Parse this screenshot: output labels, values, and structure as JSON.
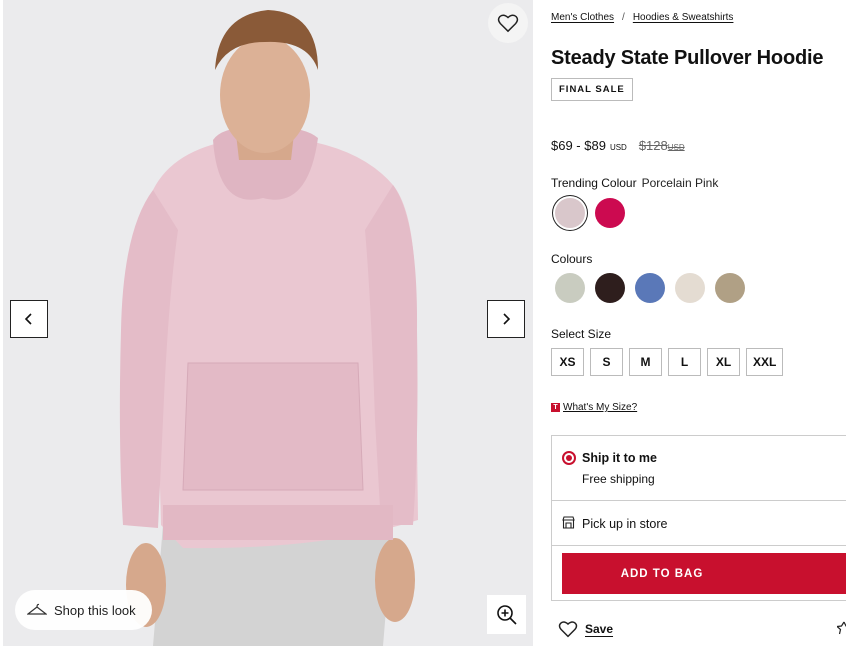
{
  "gallery": {
    "shop_look_label": "Shop this look",
    "icons": [
      "heart-icon",
      "chevron-left-icon",
      "chevron-right-icon",
      "hanger-icon",
      "zoom-in-icon"
    ]
  },
  "breadcrumb": [
    {
      "label": "Men's Clothes"
    },
    {
      "label": "Hoodies & Sweatshirts"
    }
  ],
  "breadcrumb_separator": "/",
  "product": {
    "title": "Steady State Pullover Hoodie",
    "badge": "FINAL SALE",
    "price_range": "$69 - $89",
    "currency": "USD",
    "original_price": "$128",
    "original_currency": "USD"
  },
  "trending": {
    "label": "Trending Colour",
    "selected_value": "Porcelain Pink",
    "swatches": [
      {
        "color": "#d9c7cb",
        "selected": true
      },
      {
        "color": "#cc0a50",
        "selected": false
      }
    ]
  },
  "colours": {
    "label": "Colours",
    "swatches": [
      {
        "color": "#c9ccc0"
      },
      {
        "color": "#2e1e1d"
      },
      {
        "color": "#5a78b8"
      },
      {
        "color": "#e4dcd2"
      },
      {
        "color": "#b0a085"
      }
    ]
  },
  "size": {
    "label": "Select Size",
    "options": [
      "XS",
      "S",
      "M",
      "L",
      "XL",
      "XXL"
    ]
  },
  "size_fit": {
    "logo_letter": "T",
    "link": "What's My Size?"
  },
  "fulfillment": {
    "ship_title": "Ship it to me",
    "ship_sub": "Free shipping",
    "pickup": "Pick up in store"
  },
  "add_to_bag": "ADD TO BAG",
  "save_label": "Save",
  "colors": {
    "accent": "#c8102e",
    "gallery_bg": "#ebebed"
  }
}
